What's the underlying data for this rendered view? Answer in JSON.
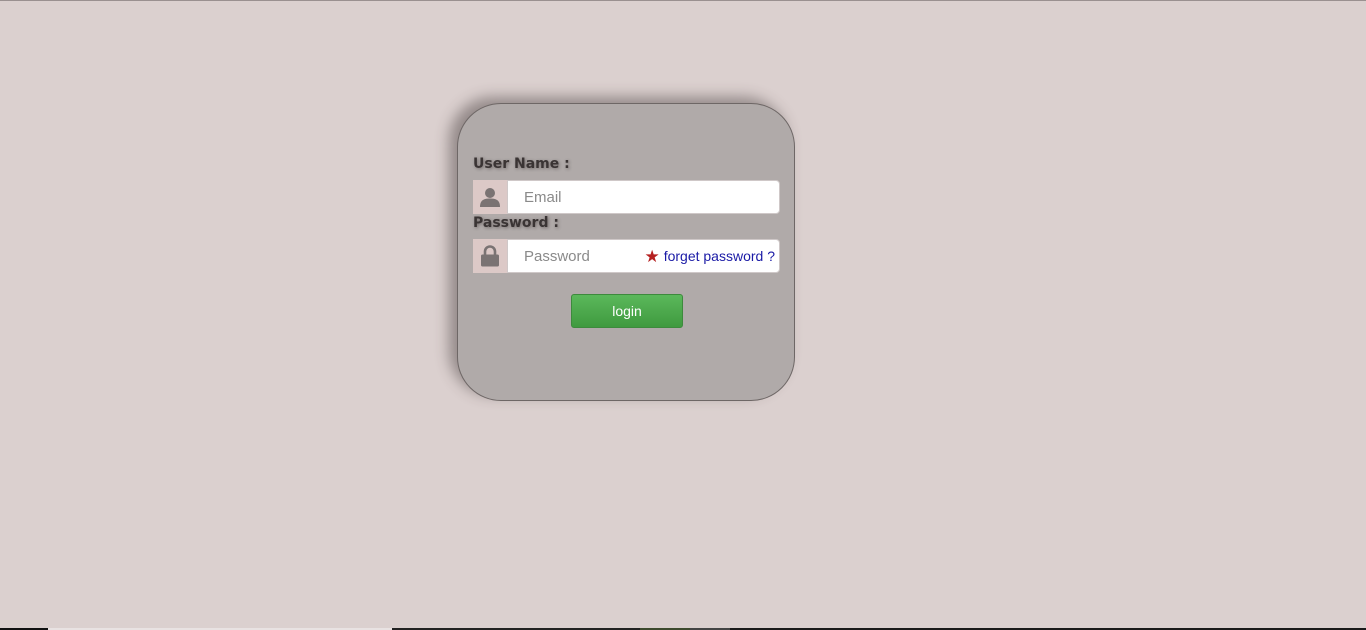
{
  "login": {
    "username_label": "User Name :",
    "username_placeholder": "Email",
    "password_label": "Password :",
    "password_placeholder": "Password",
    "forgot_link": "forget password ?",
    "login_button": "login"
  },
  "icons": {
    "username": "user-icon",
    "password": "lock-icon",
    "required": "star-icon"
  },
  "colors": {
    "page_background": "#dbd0cf",
    "card_background": "#b0aaa9",
    "login_button": "#4caf50",
    "link": "#1a1aa6",
    "star": "#b52020"
  }
}
